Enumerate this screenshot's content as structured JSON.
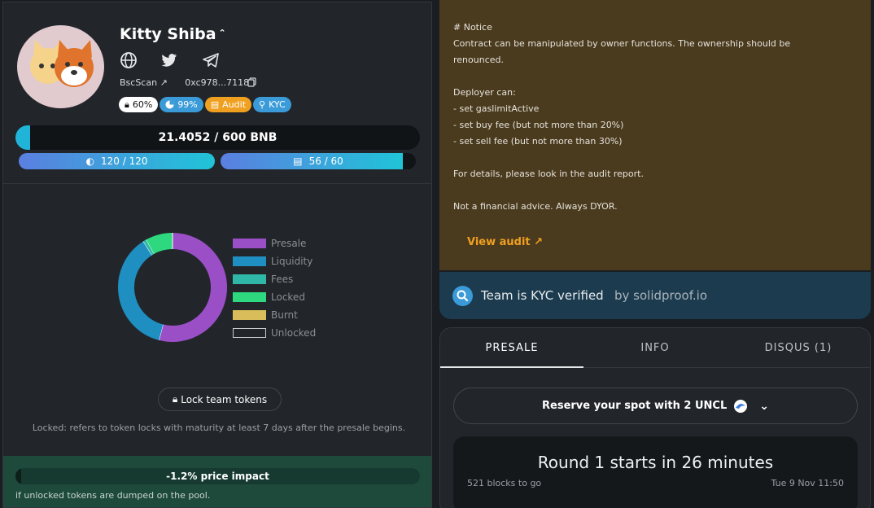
{
  "token": {
    "name": "Kitty Shiba",
    "bscscan_label": "BscScan",
    "address": "0xc978...7118",
    "badges": {
      "lock": "60%",
      "pie": "99%",
      "audit": "Audit",
      "kyc": "KYC"
    }
  },
  "raise": {
    "text": "21.4052 / 600 BNB",
    "progress": 0.036,
    "slots_text": "120 / 120",
    "slots_progress": 1.0,
    "whitelist_text": "56 / 60",
    "whitelist_progress": 0.933
  },
  "chart_data": {
    "type": "pie",
    "labels": [
      "Presale",
      "Liquidity",
      "Fees",
      "Locked",
      "Burnt",
      "Unlocked"
    ],
    "values": [
      54,
      37,
      1,
      8,
      0,
      0
    ],
    "colors": [
      "#9b4fc7",
      "#1e8fc0",
      "#2fb8a8",
      "#2ed87f",
      "#d8bd5a",
      "#22262b"
    ]
  },
  "lock_button": "Lock team tokens",
  "locked_note": "Locked: refers to token locks with maturity at least 7 days after the presale begins.",
  "impact": {
    "text": "-1.2% price impact",
    "progress": 0.012,
    "note": "if unlocked tokens are dumped on the pool."
  },
  "notice": {
    "lines": [
      "# Notice",
      "Contract can be manipulated by owner functions. The ownership should be",
      "renounced.",
      "",
      "Deployer can:",
      "- set gaslimitActive",
      "- set buy fee (but not more than 20%)",
      "- set sell fee (but not more than 30%)",
      "",
      "For details, please look in the audit report.",
      "",
      "Not a financial advice. Always DYOR."
    ],
    "view_audit": "View audit ↗"
  },
  "kyc": {
    "text": "Team is KYC verified",
    "by": "by solidproof.io"
  },
  "tabs": [
    "PRESALE",
    "INFO",
    "DISQUS (1)"
  ],
  "reserve": "Reserve your spot with 2 UNCL",
  "round": {
    "title": "Round 1 starts in 26 minutes",
    "blocks": "521 blocks to go",
    "date": "Tue 9 Nov 11:50"
  }
}
